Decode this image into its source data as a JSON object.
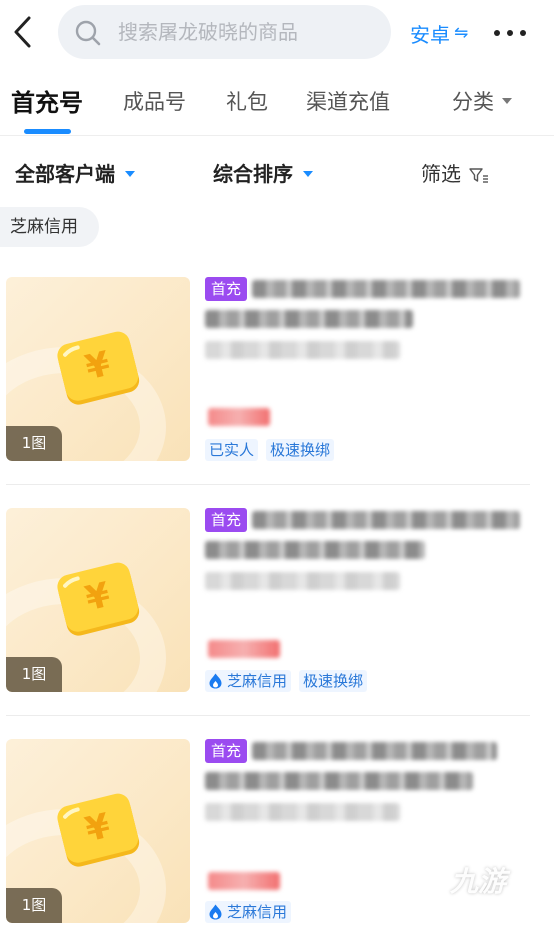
{
  "header": {
    "search_placeholder": "搜索屠龙破晓的商品",
    "platform_label": "安卓",
    "platform_swap_icon": "⇋"
  },
  "tabs": [
    {
      "label": "首充号",
      "active": true
    },
    {
      "label": "成品号",
      "active": false
    },
    {
      "label": "礼包",
      "active": false
    },
    {
      "label": "渠道充值",
      "active": false
    },
    {
      "label": "分类",
      "active": false
    }
  ],
  "filters": {
    "client": "全部客户端",
    "sort": "综合排序",
    "screen": "筛选"
  },
  "chip_label": "芝麻信用",
  "listings": [
    {
      "badge": "首充",
      "image_count": "1图",
      "tags": [
        {
          "label": "已实人",
          "icon": ""
        },
        {
          "label": "极速换绑",
          "icon": ""
        }
      ]
    },
    {
      "badge": "首充",
      "image_count": "1图",
      "tags": [
        {
          "label": "芝麻信用",
          "icon": "flame-icon"
        },
        {
          "label": "极速换绑",
          "icon": ""
        }
      ]
    },
    {
      "badge": "首充",
      "image_count": "1图",
      "tags": [
        {
          "label": "芝麻信用",
          "icon": "flame-icon"
        }
      ]
    }
  ],
  "watermark": "九游",
  "colors": {
    "accent": "#1a8cff",
    "badge": "#9b4bf0",
    "price": "#f27070"
  }
}
